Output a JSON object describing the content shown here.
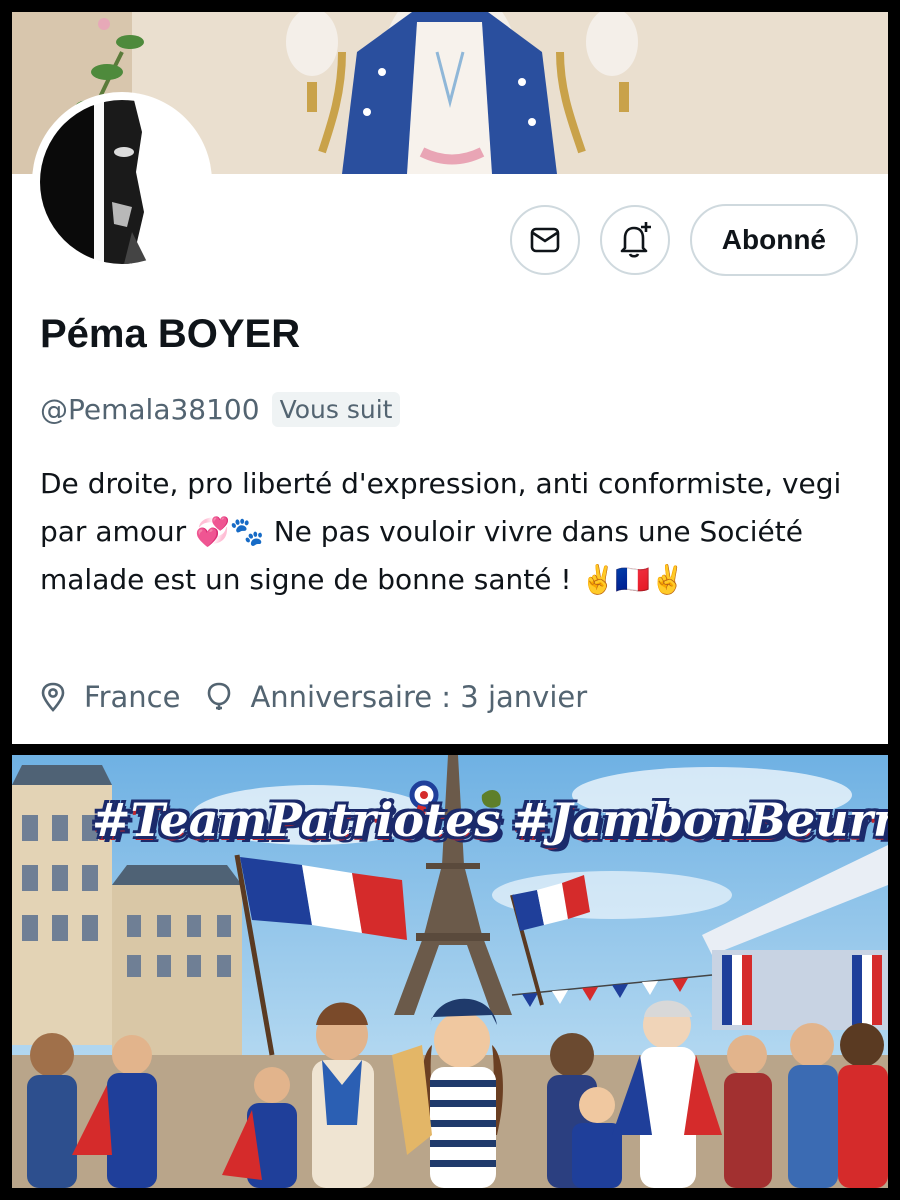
{
  "profile": {
    "name": "Péma BOYER",
    "handle": "@Pemala38100",
    "follows_you": "Vous suit",
    "bio": "De droite, pro liberté d'expression, anti conformiste, vegi par amour 💞🐾 Ne pas vouloir vivre dans une Société malade est un signe de bonne santé ! ✌️🇫🇷✌️",
    "location": "France",
    "birthday": "Anniversaire : 3 janvier"
  },
  "actions": {
    "message_icon": "envelope-icon",
    "notify_icon": "bell-plus-icon",
    "follow_label": "Abonné"
  },
  "poster": {
    "hashtag1": "#TeamPatriotes",
    "hashtag2": "#JambonBeurre"
  },
  "colors": {
    "text_primary": "#0f1419",
    "text_secondary": "#536471",
    "border": "#cfd9de",
    "flag_blue": "#1f3f9a",
    "flag_red": "#d52b2b"
  }
}
